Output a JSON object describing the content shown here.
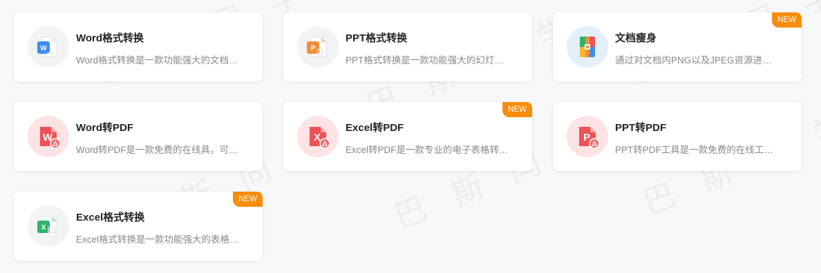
{
  "watermark_text": "巴 斯 同 学",
  "cards": [
    {
      "title": "Word格式转换",
      "desc": "Word格式转换是一款功能强大的文档格式转换工具",
      "badge": ""
    },
    {
      "title": "PPT格式转换",
      "desc": "PPT格式转换是一款功能强大的幻灯片格式转换工具",
      "badge": ""
    },
    {
      "title": "文档瘦身",
      "desc": "通过对文档内PNG以及JPEG资源进行压缩，减小文档体积",
      "badge": "NEW"
    },
    {
      "title": "Word转PDF",
      "desc": "Word转PDF是一款免费的在线具，可以快速转换",
      "badge": ""
    },
    {
      "title": "Excel转PDF",
      "desc": "Excel转PDF是一款专业的电子表格转换工具",
      "badge": "NEW"
    },
    {
      "title": "PPT转PDF",
      "desc": "PPT转PDF工具是一款免费的在线工具，可以快速转换",
      "badge": ""
    },
    {
      "title": "Excel格式转换",
      "desc": "Excel格式转换是一款功能强大的表格格式转换工具",
      "badge": "NEW"
    }
  ],
  "colors": {
    "word_blue": "#3d8bf0",
    "ppt_orange": "#f08d3a",
    "pdf_red": "#ee5257",
    "excel_green": "#2fb36b",
    "badge_orange": "#f78d0b"
  },
  "icons": [
    "word-doc-icon",
    "ppt-doc-icon",
    "file-compress-icon",
    "word-to-pdf-icon",
    "excel-to-pdf-icon",
    "ppt-to-pdf-icon",
    "excel-doc-icon"
  ]
}
